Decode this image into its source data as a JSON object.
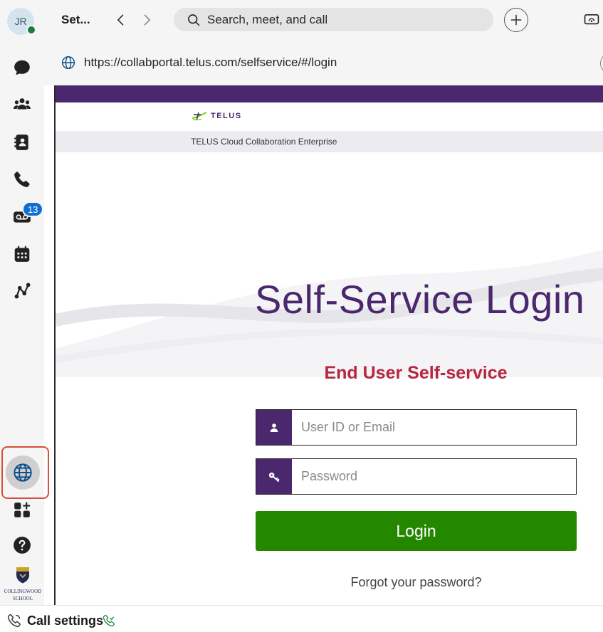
{
  "user": {
    "initials": "JR"
  },
  "rail": {
    "items": [
      {
        "icon": "chat-icon"
      },
      {
        "icon": "teams-icon"
      },
      {
        "icon": "contacts-icon"
      },
      {
        "icon": "phone-icon"
      },
      {
        "icon": "voicemail-icon",
        "badge": "13"
      },
      {
        "icon": "calendar-icon"
      },
      {
        "icon": "connections-icon"
      },
      {
        "icon": "globe-icon"
      },
      {
        "icon": "apps-icon"
      },
      {
        "icon": "help-icon"
      }
    ],
    "school_name_line1": "COLLINGWOOD",
    "school_name_line2": "SCHOOL"
  },
  "topbar": {
    "tab_title": "Set...",
    "search_placeholder": "Search, meet, and call"
  },
  "urlbar": {
    "url": "https://collabportal.telus.com/selfservice/#/login"
  },
  "page": {
    "brand": "TELUS",
    "product": "TELUS Cloud Collaboration Enterprise",
    "title": "Self-Service Login",
    "subtitle": "End User Self-service",
    "user_placeholder": "User ID or Email",
    "password_placeholder": "Password",
    "login_label": "Login",
    "forgot_label": "Forgot your password?"
  },
  "statusbar": {
    "call_settings_label": "Call settings"
  },
  "colors": {
    "telus_purple": "#4b286d",
    "login_green": "#248700",
    "subtitle_red": "#b6263f",
    "highlight": "#d94f3a",
    "badge_blue": "#1170cf"
  }
}
